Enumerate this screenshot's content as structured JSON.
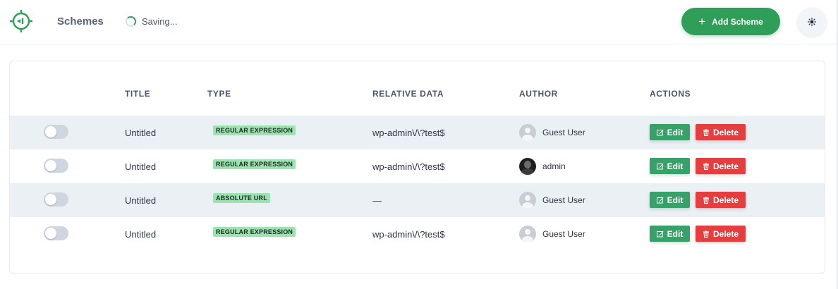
{
  "header": {
    "title": "Schemes",
    "status": "Saving...",
    "add_button_icon": "plus-icon",
    "add_button_label": "Add Scheme",
    "theme_icon": "sun-icon",
    "logo_icon": "crosshair-logo-icon",
    "accent_color": "#2f9e58"
  },
  "table": {
    "columns": {
      "title": "TITLE",
      "type": "TYPE",
      "relative_data": "RELATIVE DATA",
      "author": "AUTHOR",
      "actions": "ACTIONS"
    },
    "rows": [
      {
        "enabled": false,
        "title": "Untitled",
        "type": "REGULAR EXPRESSION",
        "relative_data": "wp-admin\\/\\?test$",
        "author": "Guest User",
        "avatar": "guest-avatar",
        "edit": "Edit",
        "delete": "Delete"
      },
      {
        "enabled": false,
        "title": "Untitled",
        "type": "REGULAR EXPRESSION",
        "relative_data": "wp-admin\\/\\?test$",
        "author": "admin",
        "avatar": "photo-avatar",
        "edit": "Edit",
        "delete": "Delete"
      },
      {
        "enabled": false,
        "title": "Untitled",
        "type": "ABSOLUTE URL",
        "relative_data": "—",
        "author": "Guest User",
        "avatar": "guest-avatar",
        "edit": "Edit",
        "delete": "Delete"
      },
      {
        "enabled": false,
        "title": "Untitled",
        "type": "REGULAR EXPRESSION",
        "relative_data": "wp-admin\\/\\?test$",
        "author": "Guest User",
        "avatar": "guest-avatar",
        "edit": "Edit",
        "delete": "Delete"
      }
    ],
    "colors": {
      "edit": "#38a169",
      "delete": "#e53e3e",
      "badge": "#9ee2b2",
      "row_shade": "#eaf0f4"
    }
  }
}
